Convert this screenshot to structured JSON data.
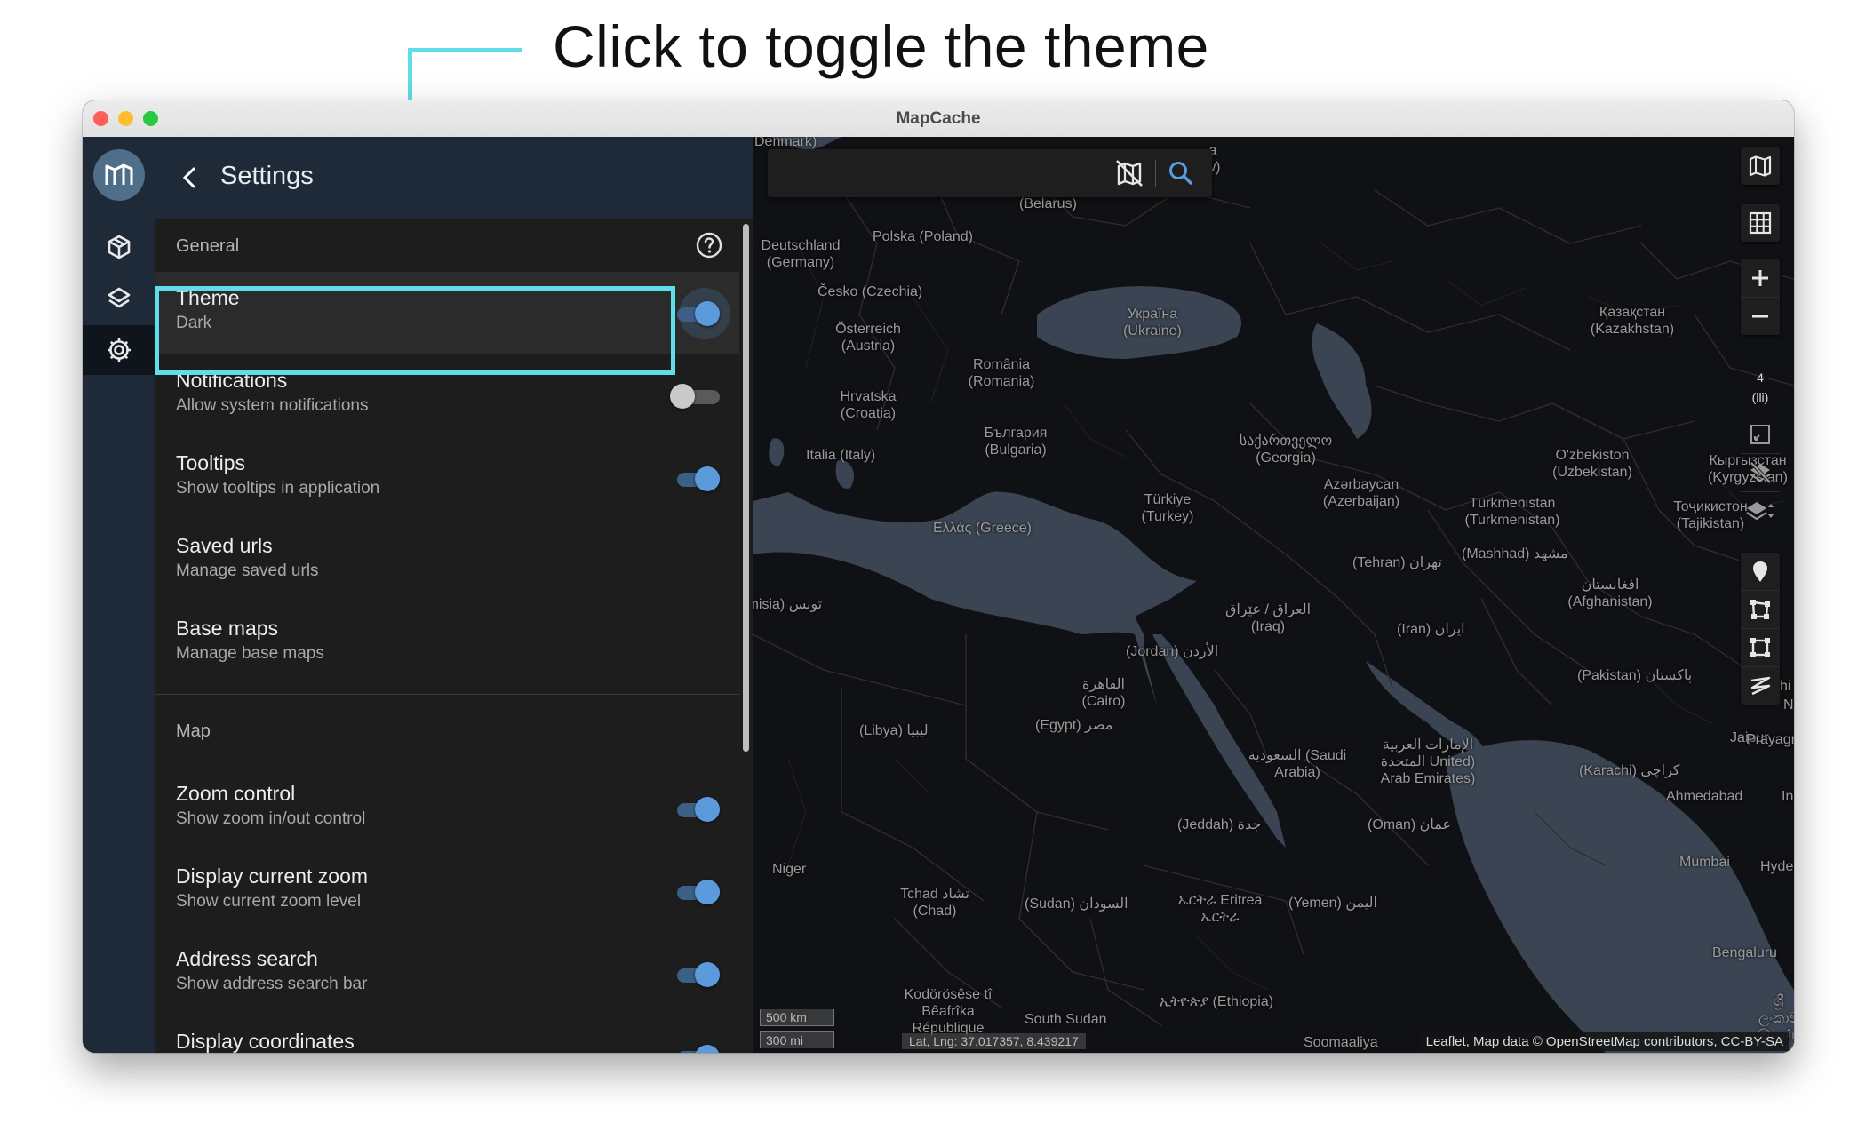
{
  "annotation": {
    "text": "Click to toggle the theme"
  },
  "window": {
    "title": "MapCache",
    "traffic_lights": {
      "close": "#ff5f57",
      "minimize": "#febc2e",
      "zoom": "#28c840"
    }
  },
  "nav_rail": {
    "items": [
      {
        "icon": "cube-icon",
        "active": false
      },
      {
        "icon": "layers-icon",
        "active": false
      },
      {
        "icon": "gear-icon",
        "active": true
      }
    ]
  },
  "settings": {
    "title": "Settings",
    "sections": {
      "general": {
        "label": "General",
        "rows": [
          {
            "title": "Theme",
            "subtitle": "Dark",
            "toggle": "on",
            "highlighted": true
          },
          {
            "title": "Notifications",
            "subtitle": "Allow system notifications",
            "toggle": "off"
          },
          {
            "title": "Tooltips",
            "subtitle": "Show tooltips in application",
            "toggle": "on"
          },
          {
            "title": "Saved urls",
            "subtitle": "Manage saved urls",
            "toggle": "none"
          },
          {
            "title": "Base maps",
            "subtitle": "Manage base maps",
            "toggle": "none"
          }
        ]
      },
      "map": {
        "label": "Map",
        "rows": [
          {
            "title": "Zoom control",
            "subtitle": "Show zoom in/out control",
            "toggle": "on"
          },
          {
            "title": "Display current zoom",
            "subtitle": "Show current zoom level",
            "toggle": "on"
          },
          {
            "title": "Address search",
            "subtitle": "Show address search bar",
            "toggle": "on"
          },
          {
            "title": "Display coordinates",
            "subtitle": "",
            "toggle": "on"
          }
        ]
      }
    }
  },
  "map": {
    "labels": [
      "Denmark)",
      "(Belarus)",
      "Polska (Poland)",
      "Deutschland (Germany)",
      "Česko (Czechia)",
      "Österreich (Austria)",
      "Україна (Ukraine)",
      "România (Romania)",
      "Hrvatska (Croatia)",
      "България (Bulgaria)",
      "Italia (Italy)",
      "Ελλάς (Greece)",
      "Türkiye (Turkey)",
      "საქართველო (Georgia)",
      "Azərbaycan (Azerbaijan)",
      "Қазақстан (Kazakhstan)",
      "O'zbekiston (Uzbekistan)",
      "Кыргызстан (Kyrgyzstan)",
      "Türkmenistan (Turkmenistan)",
      "Тоҷикистон (Tajikistan)",
      "(Tehran) تهران",
      "(Mashhad) مشهد",
      "افغانستان (Afghanistan)",
      "nisia) تونس",
      "العراق / عێراق (Iraq)",
      "(Iran) ايران",
      "(Jordan) الأردن",
      "القاهرة (Cairo)",
      "(Libya) ليبيا",
      "(Egypt) مصر",
      "(Pakistan) پاکستان",
      "Delhi",
      "الإمارات العربية المتحدة United) Arab Emirates)",
      "السعودية (Saudi Arabia)",
      "(Karachi) کراچی",
      "Jaipur",
      "Prayagra",
      "Ahmedabad",
      "India",
      "(Jeddah) جدة",
      "(Oman) عمان",
      "Niger",
      "Tchad تشاد (Chad)",
      "(Sudan) السودان",
      "ኤርትራ Eritrea ኤርትራ",
      "(Yemen) اليمن",
      "Mumbai",
      "Hyderabad",
      "Bengaluru",
      "ኢትዮጵያ (Ethiopia)",
      "South Sudan",
      "Kodörösêse tî Bêafrîka République",
      "Soomaaliya",
      "ශ්‍රී ලංකාව இலங்கை",
      "a w)",
      "Ne"
    ],
    "zoom_level": "4",
    "zoom_level_suffix": "(lli)",
    "scale": {
      "km": "500 km",
      "mi": "300 mi"
    },
    "coordinates": "Lat, Lng: 37.017357, 8.439217",
    "attribution": "Leaflet, Map data © OpenStreetMap contributors, CC-BY-SA",
    "search_placeholder": ""
  },
  "colors": {
    "accent": "#5fdde8",
    "toggle_on": "#5b9bdc",
    "header_bg": "#1e2a38",
    "panel_bg": "#1d1d1d",
    "map_bg": "#101114"
  }
}
